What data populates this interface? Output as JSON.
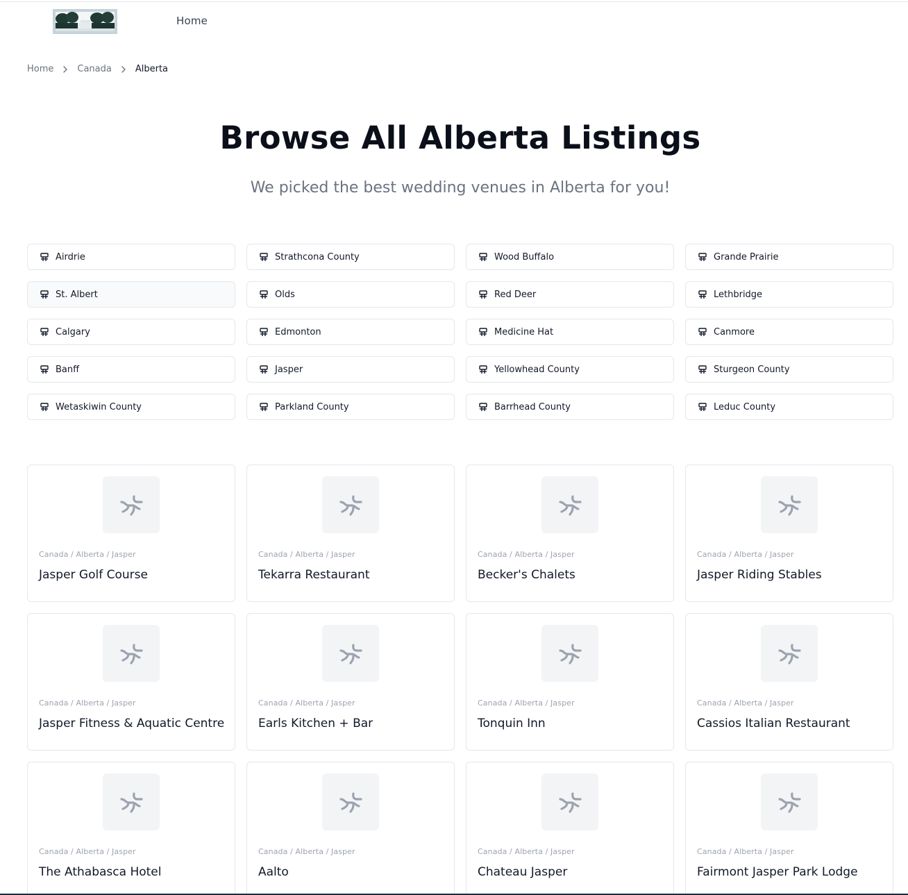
{
  "header": {
    "nav": {
      "home": "Home"
    }
  },
  "breadcrumb": [
    "Home",
    "Canada",
    "Alberta"
  ],
  "page": {
    "title": "Browse All Alberta Listings",
    "subtitle": "We picked the best wedding venues in Alberta for you!"
  },
  "cities": [
    "Airdrie",
    "Strathcona County",
    "Wood Buffalo",
    "Grande Prairie",
    "St. Albert",
    "Olds",
    "Red Deer",
    "Lethbridge",
    "Calgary",
    "Edmonton",
    "Medicine Hat",
    "Canmore",
    "Banff",
    "Jasper",
    "Yellowhead County",
    "Sturgeon County",
    "Wetaskiwin County",
    "Parkland County",
    "Barrhead County",
    "Leduc County"
  ],
  "city_icon": "signpost-icon",
  "listings": [
    {
      "path": "Canada / Alberta / Jasper",
      "name": "Jasper Golf Course"
    },
    {
      "path": "Canada / Alberta / Jasper",
      "name": "Tekarra Restaurant"
    },
    {
      "path": "Canada / Alberta / Jasper",
      "name": "Becker's Chalets"
    },
    {
      "path": "Canada / Alberta / Jasper",
      "name": "Jasper Riding Stables"
    },
    {
      "path": "Canada / Alberta / Jasper",
      "name": "Jasper Fitness & Aquatic Centre"
    },
    {
      "path": "Canada / Alberta / Jasper",
      "name": "Earls Kitchen + Bar"
    },
    {
      "path": "Canada / Alberta / Jasper",
      "name": "Tonquin Inn"
    },
    {
      "path": "Canada / Alberta / Jasper",
      "name": "Cassios Italian Restaurant"
    },
    {
      "path": "Canada / Alberta / Jasper",
      "name": "The Athabasca Hotel"
    },
    {
      "path": "Canada / Alberta / Jasper",
      "name": "Aalto"
    },
    {
      "path": "Canada / Alberta / Jasper",
      "name": "Chateau Jasper"
    },
    {
      "path": "Canada / Alberta / Jasper",
      "name": "Fairmont Jasper Park Lodge"
    }
  ],
  "listing_icon": "route-placeholder-icon",
  "colors": {
    "border": "#e5e7eb",
    "muted_text": "#6b7280",
    "placeholder_bg": "#f3f4f6",
    "placeholder_icon": "#9ca3af"
  }
}
